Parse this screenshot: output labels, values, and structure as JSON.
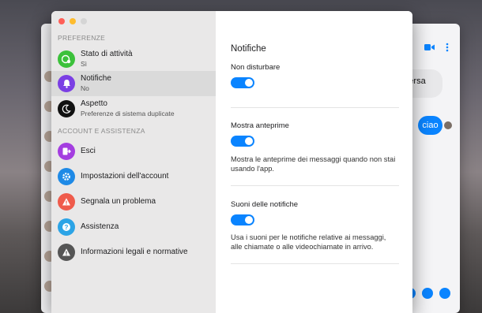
{
  "background_chat": {
    "gray_bubble_text": "a persa",
    "blue_bubble_text": "ciao"
  },
  "sidebar": {
    "section_preferences": "PREFERENZE",
    "section_account": "ACCOUNT E ASSISTENZA",
    "items": [
      {
        "label": "Stato di attività",
        "sub": "Sì",
        "icon": "activity-status-icon",
        "color": "#3cc13b"
      },
      {
        "label": "Notifiche",
        "sub": "No",
        "icon": "bell-icon",
        "color": "#7b3fe4"
      },
      {
        "label": "Aspetto",
        "sub": "Preferenze di sistema duplicate",
        "icon": "moon-icon",
        "color": "#111111"
      },
      {
        "label": "Esci",
        "icon": "logout-icon",
        "color": "#a43ee0"
      },
      {
        "label": "Impostazioni dell'account",
        "icon": "gear-icon",
        "color": "#1f8ae6"
      },
      {
        "label": "Segnala un problema",
        "icon": "warning-icon",
        "color": "#ef5b4b"
      },
      {
        "label": "Assistenza",
        "icon": "help-icon",
        "color": "#2ca4e6"
      },
      {
        "label": "Informazioni legali e normative",
        "icon": "info-warning-icon",
        "color": "#555555"
      }
    ]
  },
  "content": {
    "title": "Notifiche",
    "settings": [
      {
        "label": "Non disturbare",
        "enabled": true,
        "description": ""
      },
      {
        "label": "Mostra anteprime",
        "enabled": true,
        "description": "Mostra le anteprime dei messaggi quando non stai usando l'app."
      },
      {
        "label": "Suoni delle notifiche",
        "enabled": true,
        "description": "Usa i suoni per le notifiche relative ai messaggi, alle chiamate o alle videochiamate in arrivo."
      }
    ]
  }
}
